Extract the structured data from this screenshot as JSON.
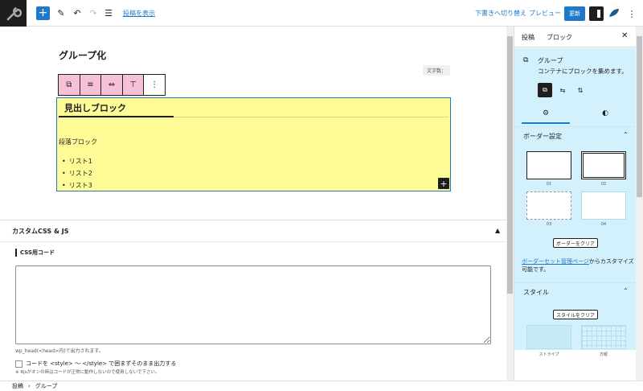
{
  "topbar": {
    "view_post": "投稿を表示",
    "switch_draft": "下書きへ切り替え",
    "preview": "プレビュー",
    "update": "更新"
  },
  "editor": {
    "title": "グループ化",
    "word_count": "文字数：",
    "heading": "見出しブロック",
    "paragraph": "段落ブロック",
    "list": [
      "リスト1",
      "リスト2",
      "リスト3"
    ]
  },
  "meta": {
    "title": "カスタムCSS & JS",
    "css_label": "CSS用コード",
    "help": "wp_head(<head>内)で出力されます。",
    "checkbox_label": "コードを <style> ～ </style> で囲まずそのまま出力する",
    "note": "※ Rjsがオンの時はコードが正常に動作しないので使用しないで下さい。"
  },
  "footer": {
    "crumb1": "投稿",
    "sep": "›",
    "crumb2": "グループ"
  },
  "sidebar": {
    "tab_post": "投稿",
    "tab_block": "ブロック",
    "block_name": "グループ",
    "block_desc": "コンテナにブロックを集めます。",
    "border_panel": "ボーダー設定",
    "border_options": [
      "01",
      "02",
      "03",
      "04"
    ],
    "clear_border": "ボーダーをクリア",
    "preset_link": "ボーダーセット管理ページ",
    "preset_suffix": "からカスタマイズ可能です。",
    "style_panel": "スタイル",
    "clear_style": "スタイルをクリア",
    "style_options": [
      "ストライプ",
      "方眼"
    ]
  },
  "colors": {
    "accent": "#1f78c8",
    "group_bg": "#fdfc96",
    "toolbar_pink": "#f6c1d6",
    "sidebar_bg": "#d3f1fd"
  }
}
